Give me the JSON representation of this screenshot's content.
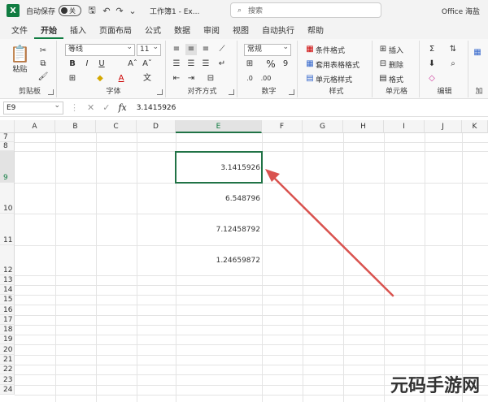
{
  "titlebar": {
    "autosave_label": "自动保存",
    "autosave_state": "关",
    "doc_title": "工作簿1 - Ex...",
    "search_placeholder": "搜索",
    "user_name": "Office 海盐"
  },
  "ribbon_tabs": [
    "文件",
    "开始",
    "插入",
    "页面布局",
    "公式",
    "数据",
    "审阅",
    "视图",
    "自动执行",
    "帮助"
  ],
  "ribbon": {
    "clipboard": {
      "label": "剪贴板",
      "paste": "粘贴"
    },
    "font": {
      "label": "字体",
      "font_name": "等线",
      "font_size": "11",
      "bold": "B",
      "italic": "I",
      "underline": "U",
      "grow": "Aˆ",
      "shrink": "Aˇ"
    },
    "alignment": {
      "label": "对齐方式"
    },
    "number": {
      "label": "数字",
      "format": "常规",
      "percent": "%",
      "comma": "9"
    },
    "styles": {
      "label": "样式",
      "conditional": "条件格式",
      "table": "套用表格格式",
      "cell_styles": "单元格样式"
    },
    "cells": {
      "label": "单元格",
      "insert": "插入",
      "delete": "删除",
      "format": "格式"
    },
    "editing": {
      "label": "编辑"
    },
    "addins": {
      "label": "加"
    }
  },
  "formula_bar": {
    "name_box": "E9",
    "fx": "fx",
    "content": "3.1415926"
  },
  "columns": [
    "A",
    "B",
    "C",
    "D",
    "E",
    "F",
    "G",
    "H",
    "I",
    "J",
    "K"
  ],
  "selected_column": "E",
  "rows": [
    "7",
    "8",
    "9",
    "10",
    "11",
    "12",
    "13",
    "14",
    "15",
    "16",
    "17",
    "18",
    "19",
    "20",
    "21",
    "22",
    "23",
    "24"
  ],
  "selected_row": "9",
  "cells": {
    "E9": "3.1415926",
    "E10": "6.548796",
    "E11": "7.12458792",
    "E12": "1.24659872"
  },
  "watermark": "元码手游网",
  "colors": {
    "accent": "#107c41",
    "selection": "#217346",
    "arrow": "#d9534f"
  }
}
